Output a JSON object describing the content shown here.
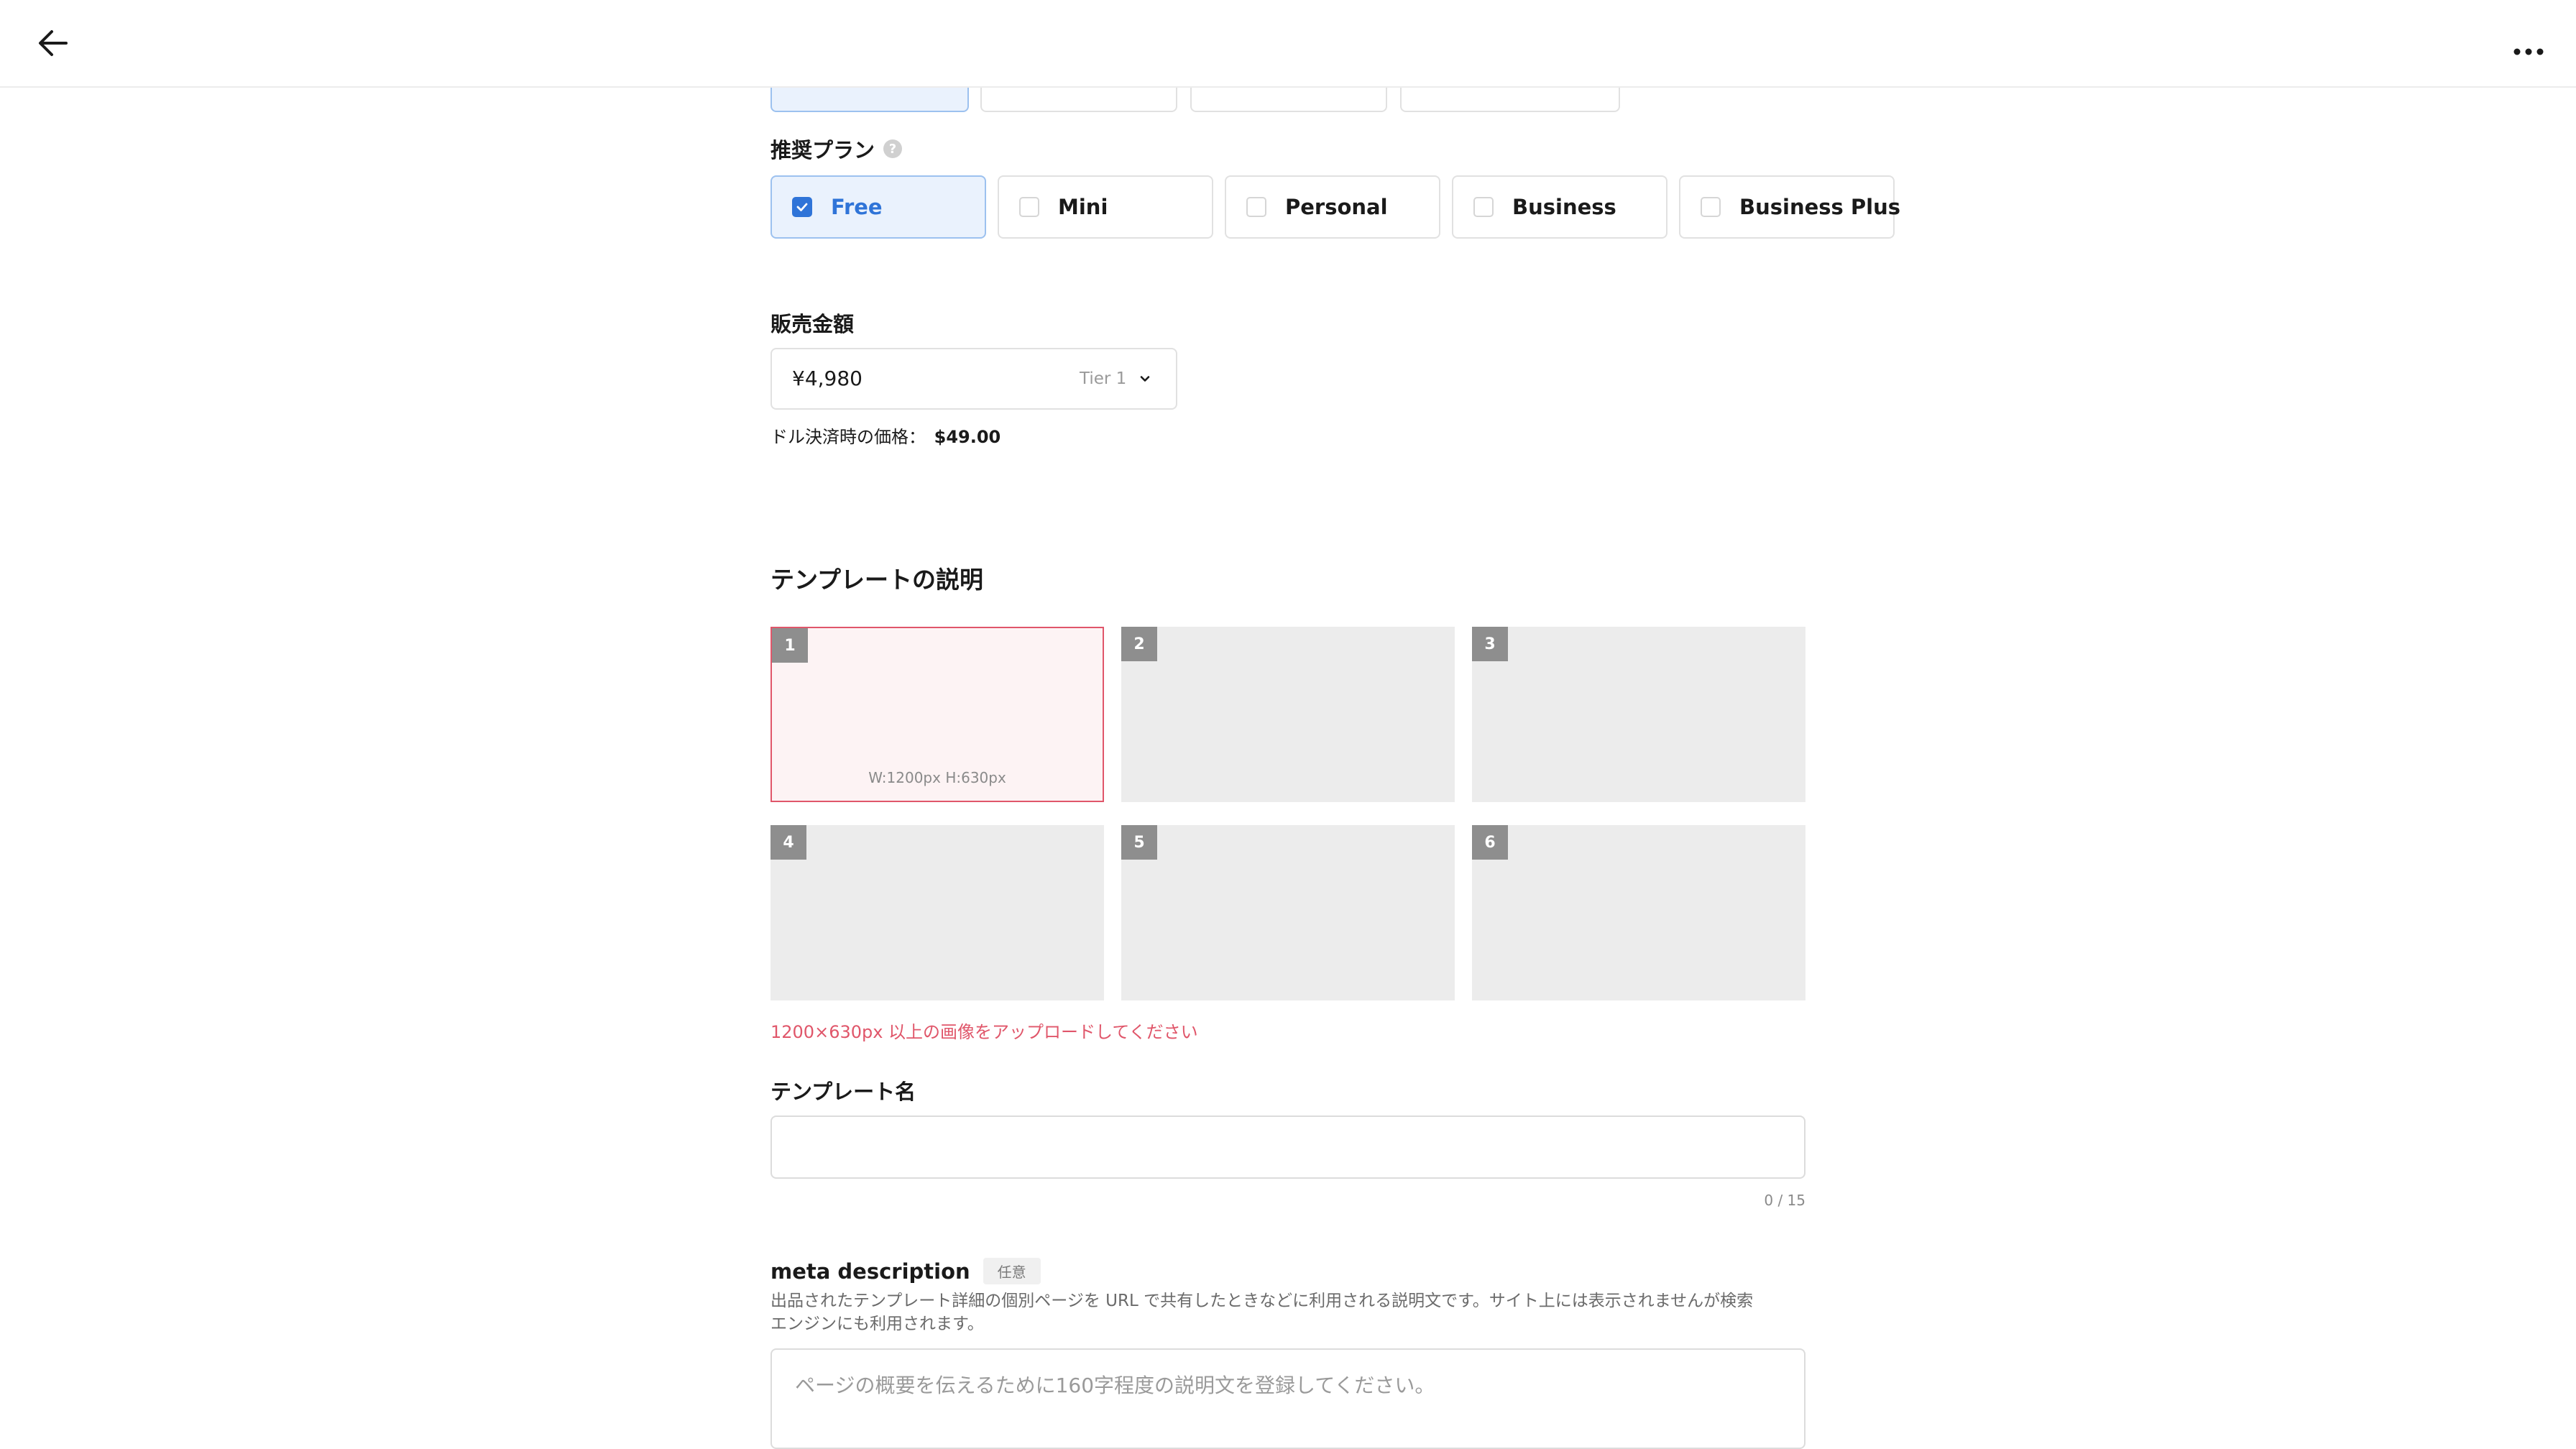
{
  "header": {
    "back_icon": "arrow-left-icon",
    "more_icon": "more-horizontal-icon"
  },
  "recommended_plan": {
    "label": "推奨プラン",
    "help_icon": "question-circle-icon",
    "plans": [
      {
        "label": "Free",
        "checked": true
      },
      {
        "label": "Mini",
        "checked": false
      },
      {
        "label": "Personal",
        "checked": false
      },
      {
        "label": "Business",
        "checked": false
      },
      {
        "label": "Business Plus",
        "checked": false
      }
    ]
  },
  "price": {
    "label": "販売金額",
    "value": "¥4,980",
    "tier": "Tier 1",
    "usd_label": "ドル決済時の価格：",
    "usd_value": "$49.00"
  },
  "description": {
    "title": "テンプレートの説明",
    "thumbs": [
      {
        "num": "1",
        "dims": "W:1200px H:630px"
      },
      {
        "num": "2"
      },
      {
        "num": "3"
      },
      {
        "num": "4"
      },
      {
        "num": "5"
      },
      {
        "num": "6"
      }
    ],
    "error": "1200×630px 以上の画像をアップロードしてください"
  },
  "template_name": {
    "label": "テンプレート名",
    "value": "",
    "counter": "0 / 15"
  },
  "meta": {
    "label": "meta description",
    "badge": "任意",
    "help_line1": "出品されたテンプレート詳細の個別ページを URL で共有したときなどに利用される説明文です。サイト上には表示されませんが検索",
    "help_line2": "エンジンにも利用されます。",
    "placeholder": "ページの概要を伝えるために160字程度の説明文を登録してください。"
  },
  "colors": {
    "accent": "#2f74d8",
    "error": "#e0566a",
    "border": "#e1e1e1"
  }
}
